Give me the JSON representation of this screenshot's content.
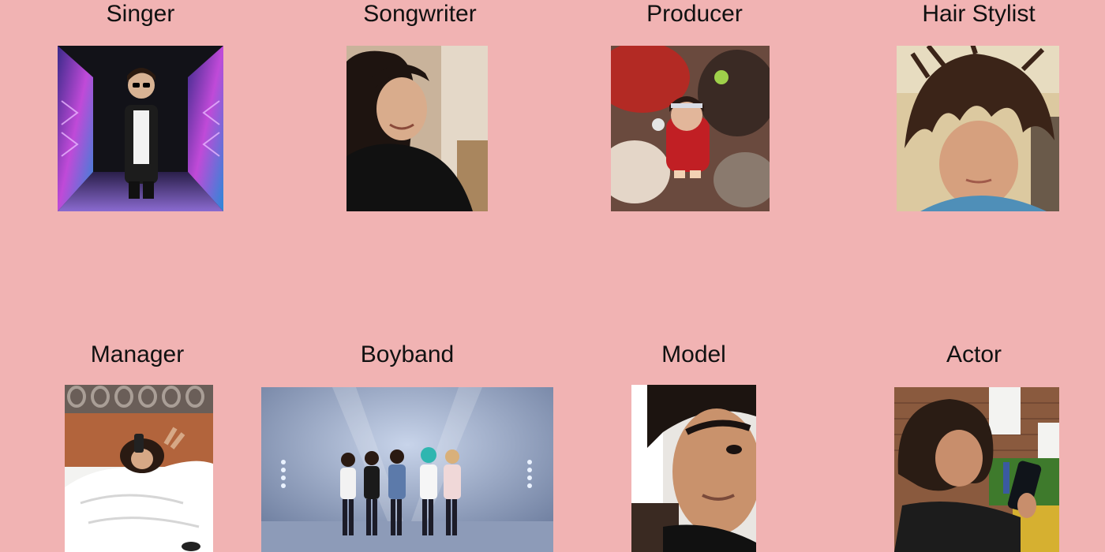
{
  "roles": {
    "singer": "Singer",
    "songwriter": "Songwriter",
    "producer": "Producer",
    "hair_stylist": "Hair Stylist",
    "manager": "Manager",
    "boyband": "Boyband",
    "model": "Model",
    "actor": "Actor"
  },
  "colors": {
    "background": "#f1b3b3",
    "text": "#111111"
  }
}
